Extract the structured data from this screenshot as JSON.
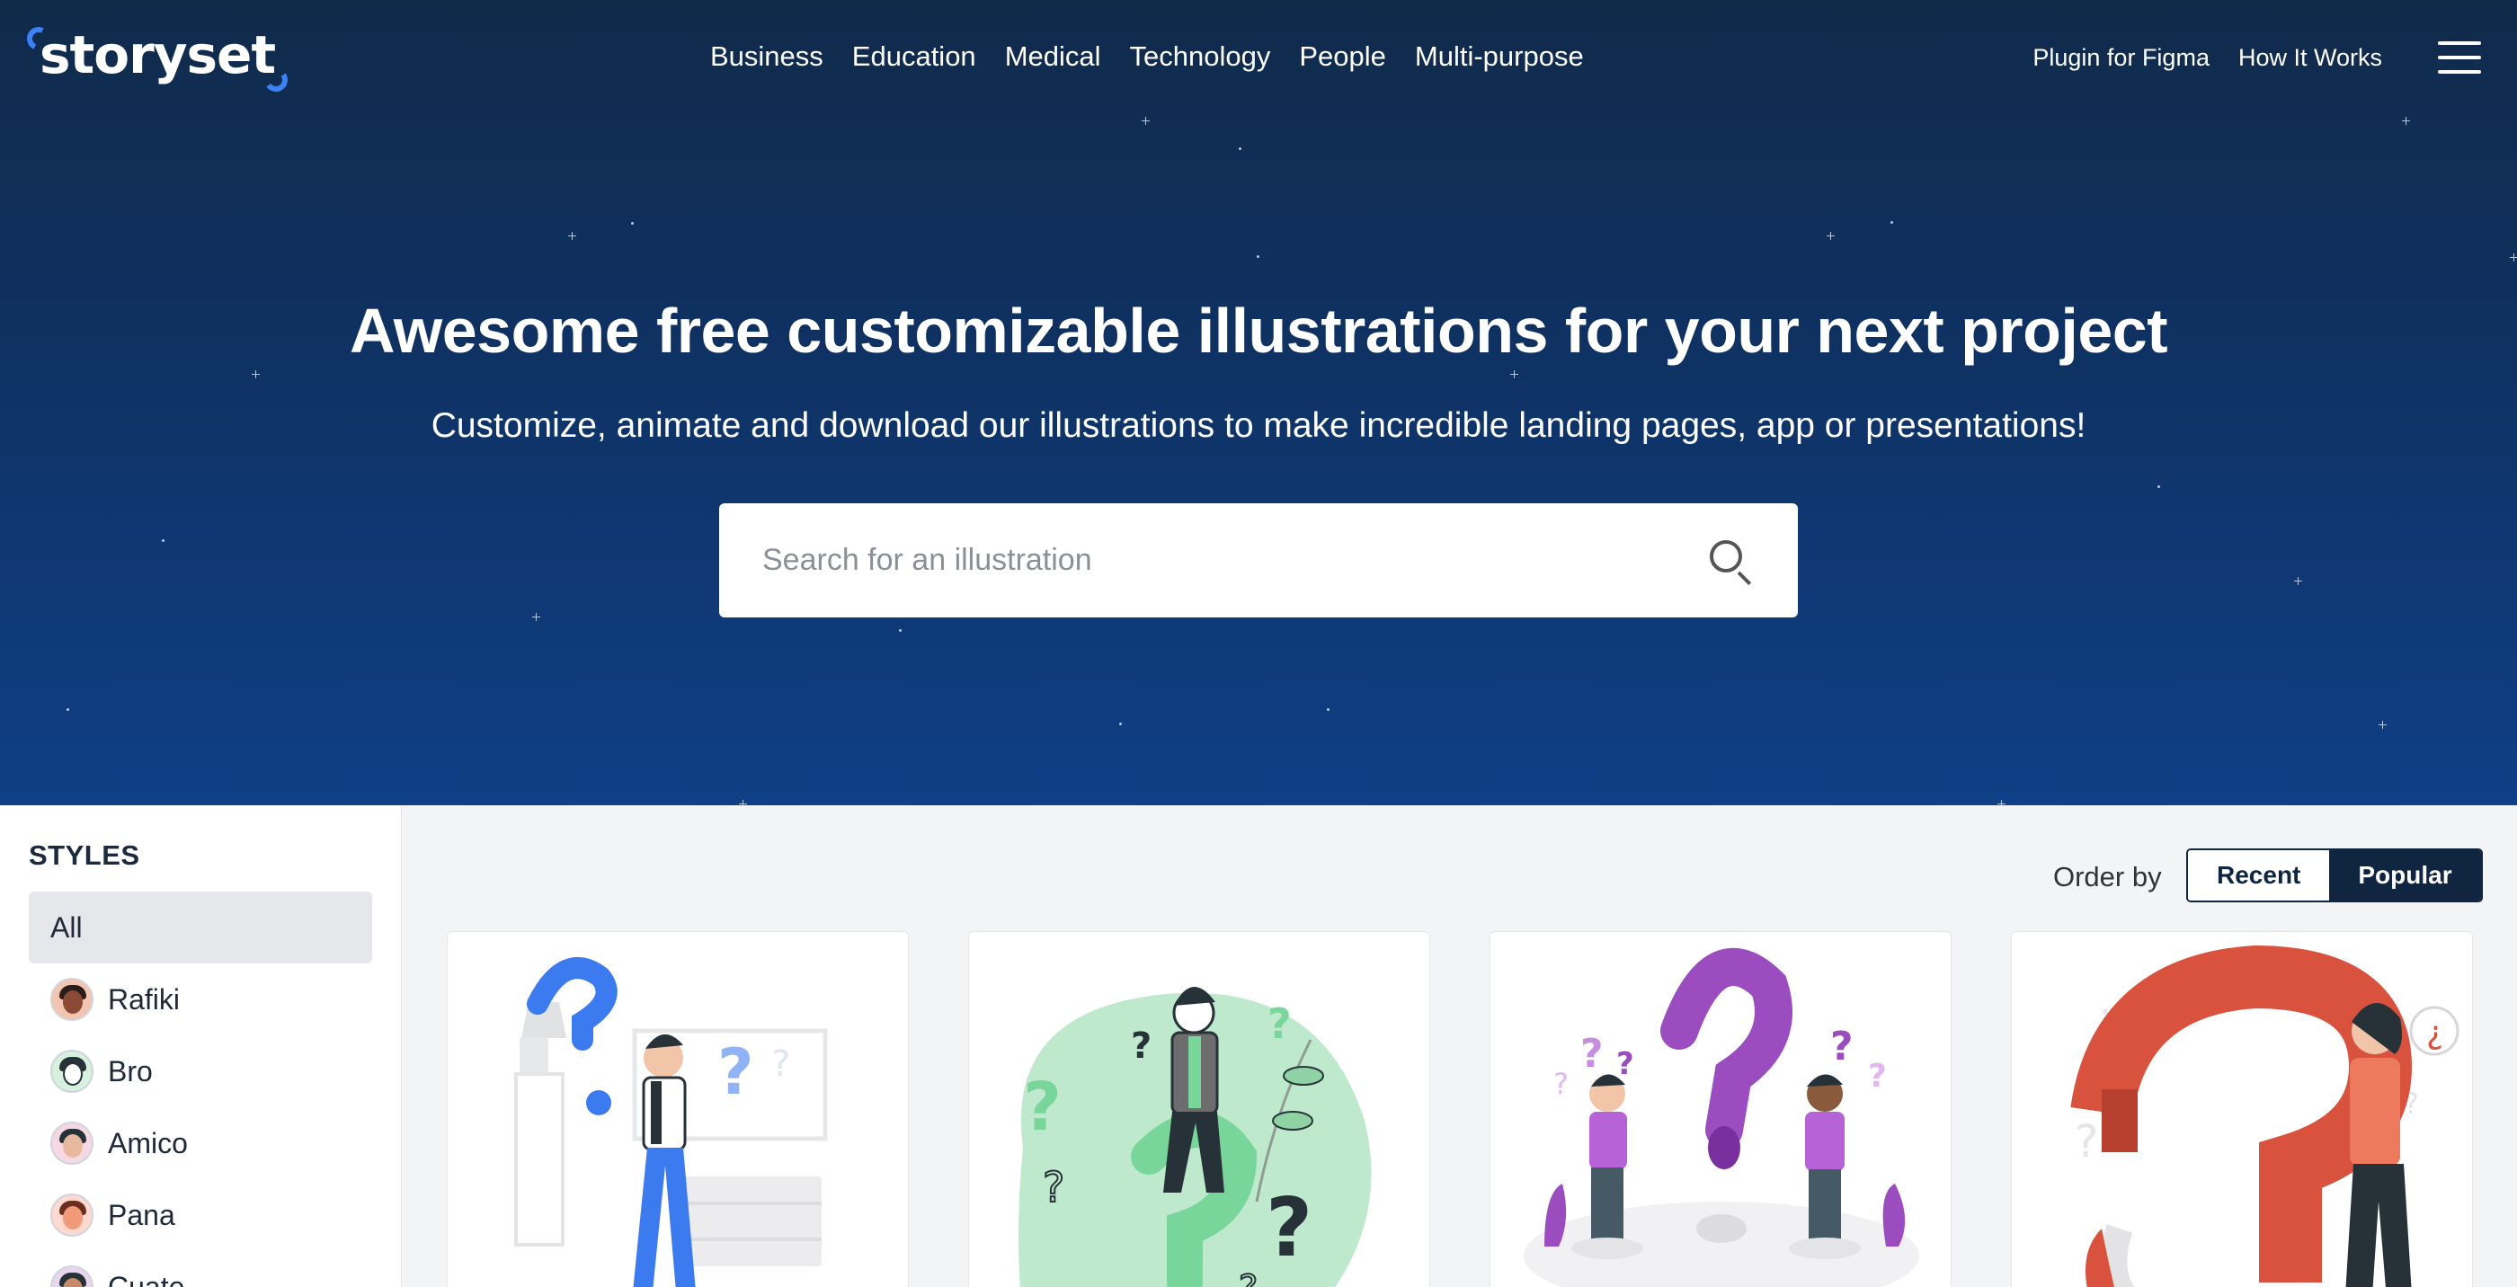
{
  "header": {
    "logo": "storyset",
    "nav": [
      "Business",
      "Education",
      "Medical",
      "Technology",
      "People",
      "Multi-purpose"
    ],
    "right_nav": [
      "Plugin for Figma",
      "How It Works"
    ],
    "menu_icon": "hamburger-icon"
  },
  "hero": {
    "title": "Awesome free customizable illustrations for your next project",
    "subtitle": "Customize, animate and download our illustrations to make incredible landing pages, app or presentations!",
    "search_placeholder": "Search for an illustration",
    "search_icon": "search-icon"
  },
  "sidebar": {
    "heading": "STYLES",
    "items": [
      {
        "label": "All",
        "active": true
      },
      {
        "label": "Rafiki",
        "avatar": "rafiki-avatar-icon"
      },
      {
        "label": "Bro",
        "avatar": "bro-avatar-icon"
      },
      {
        "label": "Amico",
        "avatar": "amico-avatar-icon"
      },
      {
        "label": "Pana",
        "avatar": "pana-avatar-icon"
      },
      {
        "label": "Cuate",
        "avatar": "cuate-avatar-icon"
      }
    ]
  },
  "order": {
    "label": "Order by",
    "options": [
      "Recent",
      "Popular"
    ],
    "selected": "Popular"
  },
  "cards": [
    {
      "illustration": "person-with-question-marks-blue",
      "accent": "#3b7bef"
    },
    {
      "illustration": "person-on-question-mark-green",
      "accent": "#79d69a"
    },
    {
      "illustration": "two-people-question-purple",
      "accent": "#9b4dbf"
    },
    {
      "illustration": "person-with-question-red",
      "accent": "#d8523d"
    }
  ],
  "colors": {
    "hero_top": "#102a4a",
    "hero_bottom": "#0f3f86",
    "dark_navy": "#0f2540"
  }
}
